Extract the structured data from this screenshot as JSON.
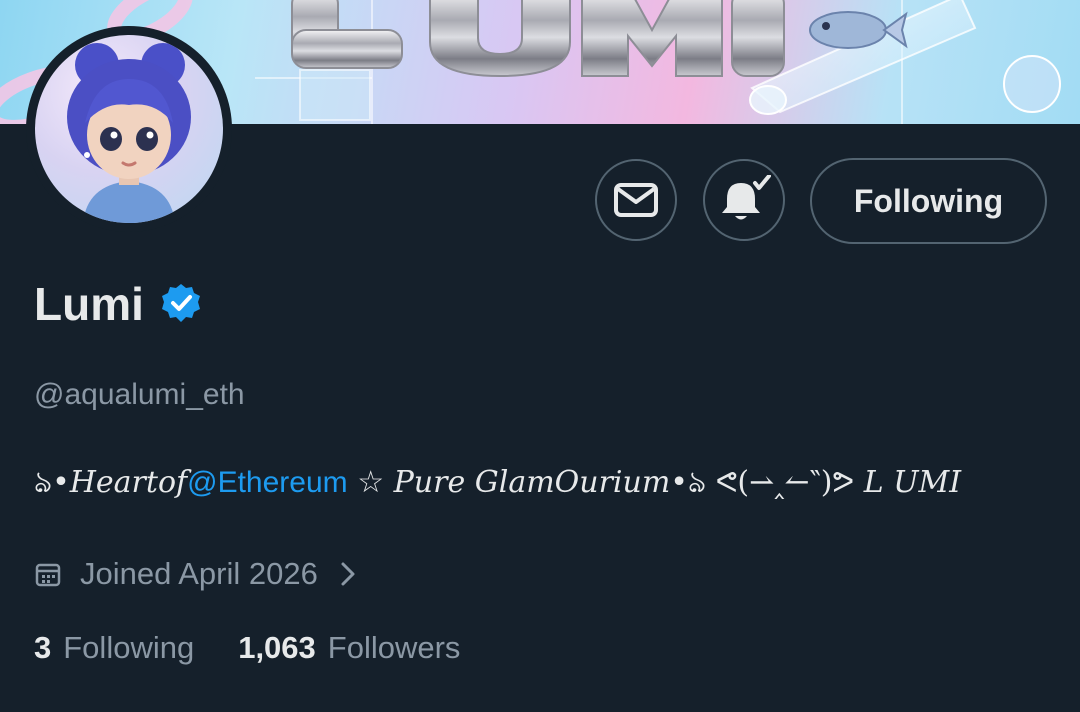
{
  "profile": {
    "display_name": "Lumi",
    "handle": "@aqualumi_eth",
    "verified": true
  },
  "banner": {
    "image_text": "LUMI"
  },
  "bio": {
    "lead_ornament": "ঌ",
    "part1": "•Heartof",
    "mention": "@Ethereum",
    "part2": " ☆ ",
    "part3": "Pure GlamOurium",
    "part4": "•ঌ",
    "part5": "  ᕙ(⇀‸↼‶)ᕗ ",
    "part6": "L UMI"
  },
  "joined": {
    "text": "Joined April 2026"
  },
  "stats": {
    "following_count": "3",
    "following_label": "Following",
    "followers_count": "1,063",
    "followers_label": "Followers"
  },
  "actions": {
    "following_button_label": "Following"
  },
  "icons": {
    "message": "envelope-icon",
    "notifications": "bell-check-icon",
    "verified": "verified-badge-icon",
    "calendar": "calendar-icon",
    "chevron": "chevron-right-icon"
  },
  "colors": {
    "background": "#15202b",
    "accent": "#1d9bf0",
    "muted": "#8b98a5",
    "border": "#536471"
  }
}
